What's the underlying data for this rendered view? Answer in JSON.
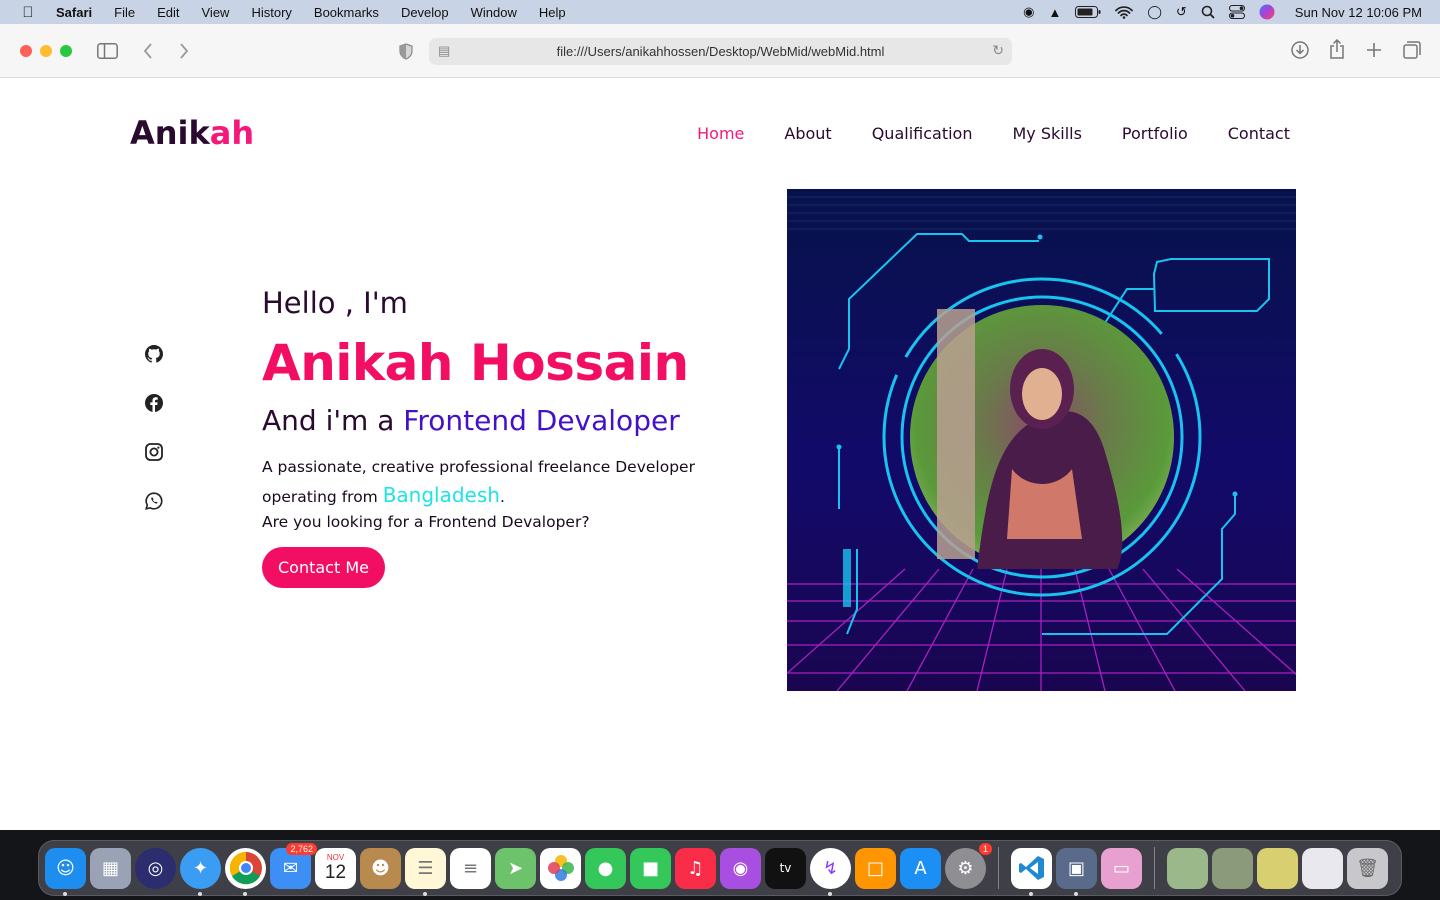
{
  "menubar": {
    "app_name": "Safari",
    "items": [
      "File",
      "Edit",
      "View",
      "History",
      "Bookmarks",
      "Develop",
      "Window",
      "Help"
    ],
    "clock": "Sun Nov 12  10:06 PM"
  },
  "browser": {
    "url": "file:///Users/anikahhossen/Desktop/WebMid/webMid.html"
  },
  "site": {
    "logo_main": "Anik",
    "logo_accent": "ah",
    "nav": [
      "Home",
      "About",
      "Qualification",
      "My Skills",
      "Portfolio",
      "Contact"
    ],
    "active_nav": "Home",
    "socials": [
      "github-icon",
      "facebook-icon",
      "instagram-icon",
      "whatsapp-icon"
    ],
    "hero": {
      "greeting": "Hello , I'm",
      "name": "Anikah Hossain",
      "role_prefix": "And i'm a ",
      "role": "Frontend Devaloper",
      "desc_1": "A passionate, creative professional freelance Developer operating from ",
      "country": "Bangladesh",
      "desc_end": ".",
      "question": "Are you looking for a Frontend Devaloper?",
      "cta": "Contact Me"
    },
    "colors": {
      "accent": "#f20e63",
      "role": "#4410c9",
      "country": "#1ee3e8",
      "text": "#2a0a2e"
    }
  },
  "dock": {
    "mail_badge": "2,762",
    "calendar_month": "NOV",
    "calendar_day": "12",
    "settings_badge": "1"
  }
}
